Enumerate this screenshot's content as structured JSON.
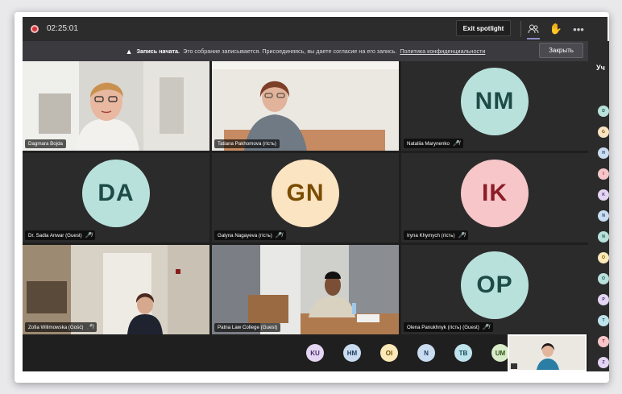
{
  "meeting": {
    "timer": "02:25:01",
    "exit_spotlight": "Exit spotlight",
    "notice_bold": "Запись начата.",
    "notice_text": "Это собрание записывается. Присоединяясь, вы даете согласие на его запись.",
    "notice_link": "Политика конфиденциальности",
    "close_button": "Закрыть"
  },
  "tiles": [
    {
      "name": "Dagmara Bojda",
      "muted": false
    },
    {
      "name": "Tatiana Pakhomova (гість)",
      "muted": false
    },
    {
      "name": "Nataliia Marynenko",
      "initials": "NM",
      "muted": true
    },
    {
      "name": "Dr. Sadia Anwar (Guest)",
      "initials": "DA",
      "muted": true
    },
    {
      "name": "Galyna Nagayeva (гість)",
      "initials": "GN",
      "muted": true
    },
    {
      "name": "Iryna Khymych (гість)",
      "initials": "IK",
      "muted": true
    },
    {
      "name": "Zofia Wilimowska (Gość)",
      "muted": true
    },
    {
      "name": "Patna Law College (Guest)",
      "muted": false
    },
    {
      "name": "Olena Panukhnyk (гість) (Guest)",
      "initials": "OP",
      "muted": true
    }
  ],
  "overflow_participants": [
    "KU",
    "HM",
    "OI",
    "N",
    "TB",
    "UM"
  ],
  "sidebar": {
    "title": "Уч",
    "items": [
      "D",
      "G",
      "H",
      "I",
      "K",
      "N",
      "N",
      "O",
      "O",
      "P",
      "T",
      "T",
      "Z"
    ]
  },
  "colors": {
    "teal_avatar": "#b9e1dc",
    "orange_avatar": "#fbe4c2",
    "pink_avatar": "#f6c6c9",
    "record": "#d13438"
  }
}
